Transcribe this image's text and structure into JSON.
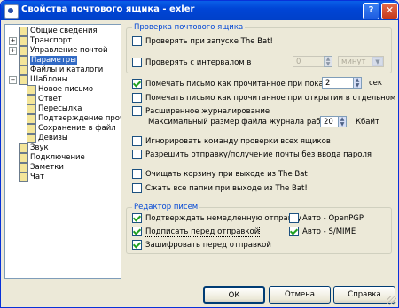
{
  "window": {
    "title": "Свойства почтового ящика - exler",
    "help_glyph": "?",
    "close_glyph": "✕"
  },
  "tree": [
    {
      "label": "Общие сведения",
      "icon": "page-icon",
      "exp": "",
      "indent": 0
    },
    {
      "label": "Транспорт",
      "icon": "transport-icon",
      "exp": "+",
      "indent": 0
    },
    {
      "label": "Управление почтой",
      "icon": "mail-manage-icon",
      "exp": "+",
      "indent": 0
    },
    {
      "label": "Параметры",
      "icon": "params-icon",
      "exp": "",
      "indent": 0,
      "selected": true
    },
    {
      "label": "Файлы и каталоги",
      "icon": "folder-icon",
      "exp": "",
      "indent": 0
    },
    {
      "label": "Шаблоны",
      "icon": "templates-icon",
      "exp": "−",
      "indent": 0
    },
    {
      "label": "Новое письмо",
      "icon": "new-mail-icon",
      "exp": "",
      "indent": 1
    },
    {
      "label": "Ответ",
      "icon": "reply-icon",
      "exp": "",
      "indent": 1
    },
    {
      "label": "Пересылка",
      "icon": "forward-icon",
      "exp": "",
      "indent": 1
    },
    {
      "label": "Подтверждение прочт",
      "icon": "confirm-icon",
      "exp": "",
      "indent": 1
    },
    {
      "label": "Сохранение в файл",
      "icon": "save-file-icon",
      "exp": "",
      "indent": 1
    },
    {
      "label": "Девизы",
      "icon": "mottos-icon",
      "exp": "",
      "indent": 1
    },
    {
      "label": "Звук",
      "icon": "sound-icon",
      "exp": "",
      "indent": 0
    },
    {
      "label": "Подключение",
      "icon": "connection-icon",
      "exp": "",
      "indent": 0
    },
    {
      "label": "Заметки",
      "icon": "notes-icon",
      "exp": "",
      "indent": 0
    },
    {
      "label": "Чат",
      "icon": "chat-icon",
      "exp": "",
      "indent": 0
    }
  ],
  "check_group": {
    "title": "Проверка почтового ящика",
    "check_on_start": "Проверять при запуске The Bat!",
    "check_interval": "Проверять с интервалом в",
    "interval_value": "0",
    "interval_unit": "минут"
  },
  "options": {
    "mark_read_timer": "Помечать письмо как прочитанное при показе в теч.",
    "mark_read_seconds": "2",
    "seconds_label": "сек",
    "mark_read_window": "Помечать письмо как прочитанное при открытии в отдельном окне",
    "extended_log": "Расширенное журналирование",
    "max_log_size_label": "Максимальный размер файла журнала работы:",
    "max_log_size_value": "20",
    "max_log_size_unit": "Кбайт",
    "ignore_check_all": "Игнорировать команду проверки всех ящиков",
    "allow_send_no_password": "Разрешить отправку/получение почты без ввода пароля",
    "empty_trash_on_exit": "Очищать корзину при выходе из The Bat!",
    "compress_on_exit": "Сжать все папки при выходе из The Bat!"
  },
  "editor_group": {
    "title": "Редактор писем",
    "confirm_immediate": "Подтверждать немедленную отправку",
    "sign_before_send": "Подписать перед отправкой",
    "encrypt_before_send": "Зашифровать перед отправкой",
    "auto_openpgp": "Авто - OpenPGP",
    "auto_smime": "Авто - S/MIME"
  },
  "buttons": {
    "ok": "ОК",
    "cancel": "Отмена",
    "help": "Справка"
  },
  "colors": {
    "titlebar": "#0045d6",
    "selection": "#316ac5",
    "group_title": "#0046d5"
  }
}
